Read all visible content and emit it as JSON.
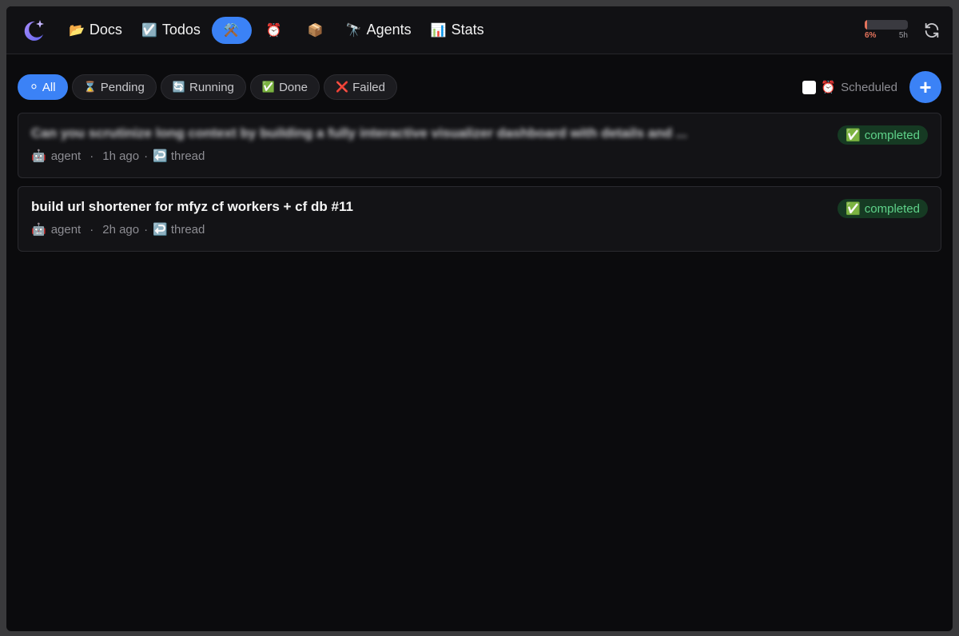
{
  "nav": {
    "items": [
      {
        "icon": "folder-icon",
        "glyph": "📂",
        "label": "Docs"
      },
      {
        "icon": "checkbox-icon",
        "glyph": "☑️",
        "label": "Todos"
      },
      {
        "icon": "hammer-and-pick-icon",
        "glyph": "⚒️",
        "label": ""
      },
      {
        "icon": "alarm-clock-icon",
        "glyph": "⏰",
        "label": ""
      },
      {
        "icon": "package-icon",
        "glyph": "📦",
        "label": ""
      },
      {
        "icon": "telescope-icon",
        "glyph": "🔭",
        "label": "Agents"
      },
      {
        "icon": "bar-chart-icon",
        "glyph": "📊",
        "label": "Stats"
      }
    ],
    "active_index": 2
  },
  "usage": {
    "percent_label": "6%",
    "fraction": 0.06,
    "window_label": "5h"
  },
  "filters": [
    {
      "icon": "white-circle-icon",
      "glyph": "⚪",
      "label": "All",
      "active": true
    },
    {
      "icon": "hourglass-icon",
      "glyph": "⌛",
      "label": "Pending"
    },
    {
      "icon": "arrows-cycle-icon",
      "glyph": "🔄",
      "label": "Running"
    },
    {
      "icon": "check-mark-icon",
      "glyph": "✅",
      "label": "Done"
    },
    {
      "icon": "cross-mark-icon",
      "glyph": "❌",
      "label": "Failed"
    }
  ],
  "scheduled": {
    "glyph": "⏰",
    "label": "Scheduled",
    "checked": false
  },
  "add_button": {
    "label": "+"
  },
  "tasks": [
    {
      "title": "Can you scrutinize long context by building a fully interactive visualizer dashboard with details and ...",
      "title_obscured": true,
      "agent_glyph": "🤖",
      "agent": "agent",
      "time": "1h ago",
      "thread_glyph": "↩️",
      "thread": "thread",
      "status_glyph": "✅",
      "status": "completed"
    },
    {
      "title": "build url shortener for mfyz cf workers + cf db #11",
      "title_obscured": false,
      "agent_glyph": "🤖",
      "agent": "agent",
      "time": "2h ago",
      "thread_glyph": "↩️",
      "thread": "thread",
      "status_glyph": "✅",
      "status": "completed"
    }
  ],
  "colors": {
    "accent": "#3b82f6",
    "success_bg": "#163a23",
    "success_text": "#5fd38a",
    "usage": "#e5735c"
  }
}
